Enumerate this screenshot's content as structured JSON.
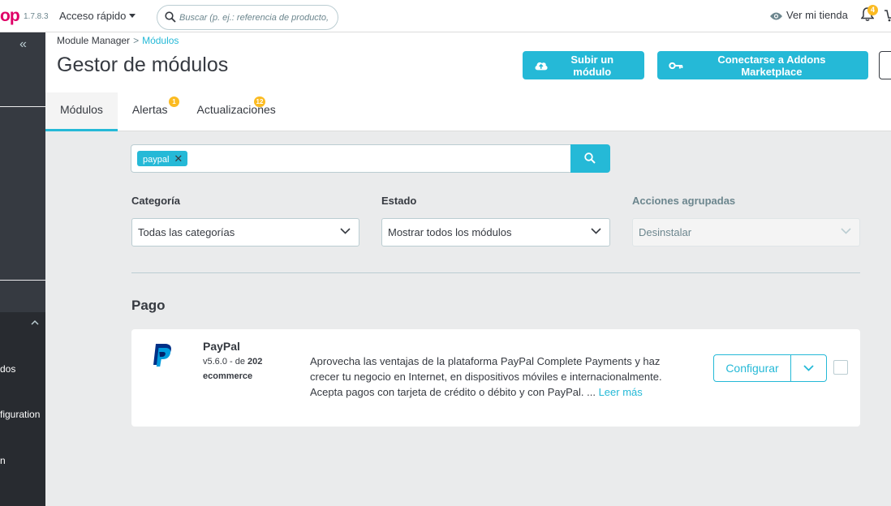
{
  "topbar": {
    "logo": "op",
    "version": "1.7.8.3",
    "quick_access": "Acceso rápido",
    "search_placeholder": "Buscar (p. ej.: referencia de producto,",
    "view_store": "Ver mi tienda",
    "notifications_count": "4"
  },
  "sidebar": {
    "collapse_glyph": "«",
    "items": [
      "dos",
      "figuration",
      "n"
    ]
  },
  "breadcrumb": {
    "parent": "Module Manager",
    "separator": ">",
    "current": "Módulos"
  },
  "page_title": "Gestor de módulos",
  "actions": {
    "upload": "Subir un módulo",
    "connect": "Conectarse a Addons Marketplace"
  },
  "tabs": [
    {
      "label": "Módulos",
      "badge": ""
    },
    {
      "label": "Alertas",
      "badge": "1"
    },
    {
      "label": "Actualizaciones",
      "badge": "12"
    }
  ],
  "search_filter": {
    "tag": "paypal",
    "remove": "✕"
  },
  "filters": {
    "category": {
      "label": "Categoría",
      "value": "Todas las categorías"
    },
    "status": {
      "label": "Estado",
      "value": "Mostrar todos los módulos"
    },
    "bulk": {
      "label": "Acciones agrupadas",
      "value": "Desinstalar"
    }
  },
  "section": {
    "title": "Pago"
  },
  "module": {
    "name": "PayPal",
    "version": "v5.6.0 - de",
    "author_part1": "202",
    "author_part2": "ecommerce",
    "description": "Aprovecha las ventajas de la plataforma PayPal Complete Payments y haz crecer tu negocio en Internet, en dispositivos móviles e internacionalmente. Acepta pagos con tarjeta de crédito o débito y con PayPal. ...",
    "read_more": "Leer más",
    "configure": "Configurar"
  },
  "colors": {
    "accent": "#25b9d7",
    "badge": "#fbbb22",
    "sidebar": "#363a41",
    "logo": "#df0067"
  },
  "icons": [
    "search-icon",
    "eye-icon",
    "bell-icon",
    "cart-icon",
    "upload-cloud-icon",
    "key-icon",
    "chevron-down-icon",
    "paypal-logo-icon"
  ]
}
